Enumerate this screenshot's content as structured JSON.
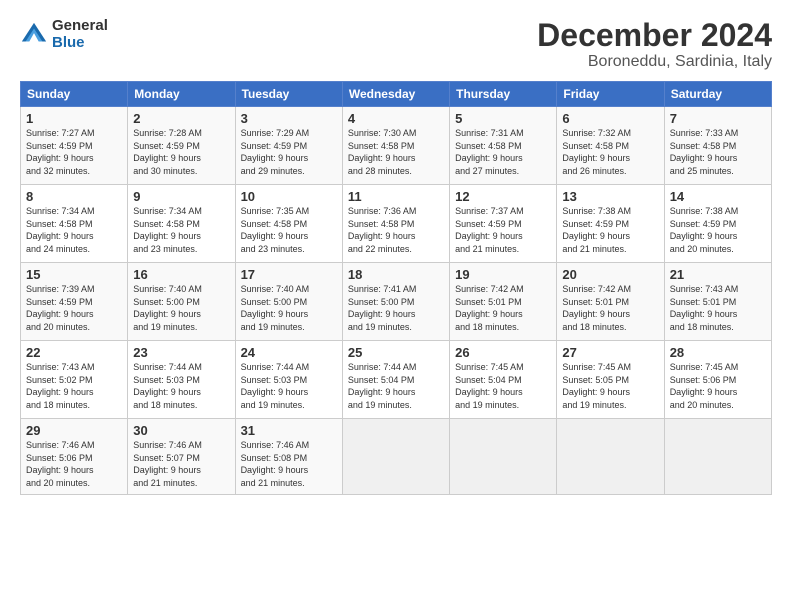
{
  "header": {
    "logo_general": "General",
    "logo_blue": "Blue",
    "month_title": "December 2024",
    "location": "Boroneddu, Sardinia, Italy"
  },
  "days_of_week": [
    "Sunday",
    "Monday",
    "Tuesday",
    "Wednesday",
    "Thursday",
    "Friday",
    "Saturday"
  ],
  "weeks": [
    [
      {
        "day": "1",
        "lines": [
          "Sunrise: 7:27 AM",
          "Sunset: 4:59 PM",
          "Daylight: 9 hours",
          "and 32 minutes."
        ]
      },
      {
        "day": "2",
        "lines": [
          "Sunrise: 7:28 AM",
          "Sunset: 4:59 PM",
          "Daylight: 9 hours",
          "and 30 minutes."
        ]
      },
      {
        "day": "3",
        "lines": [
          "Sunrise: 7:29 AM",
          "Sunset: 4:59 PM",
          "Daylight: 9 hours",
          "and 29 minutes."
        ]
      },
      {
        "day": "4",
        "lines": [
          "Sunrise: 7:30 AM",
          "Sunset: 4:58 PM",
          "Daylight: 9 hours",
          "and 28 minutes."
        ]
      },
      {
        "day": "5",
        "lines": [
          "Sunrise: 7:31 AM",
          "Sunset: 4:58 PM",
          "Daylight: 9 hours",
          "and 27 minutes."
        ]
      },
      {
        "day": "6",
        "lines": [
          "Sunrise: 7:32 AM",
          "Sunset: 4:58 PM",
          "Daylight: 9 hours",
          "and 26 minutes."
        ]
      },
      {
        "day": "7",
        "lines": [
          "Sunrise: 7:33 AM",
          "Sunset: 4:58 PM",
          "Daylight: 9 hours",
          "and 25 minutes."
        ]
      }
    ],
    [
      {
        "day": "8",
        "lines": [
          "Sunrise: 7:34 AM",
          "Sunset: 4:58 PM",
          "Daylight: 9 hours",
          "and 24 minutes."
        ]
      },
      {
        "day": "9",
        "lines": [
          "Sunrise: 7:34 AM",
          "Sunset: 4:58 PM",
          "Daylight: 9 hours",
          "and 23 minutes."
        ]
      },
      {
        "day": "10",
        "lines": [
          "Sunrise: 7:35 AM",
          "Sunset: 4:58 PM",
          "Daylight: 9 hours",
          "and 23 minutes."
        ]
      },
      {
        "day": "11",
        "lines": [
          "Sunrise: 7:36 AM",
          "Sunset: 4:58 PM",
          "Daylight: 9 hours",
          "and 22 minutes."
        ]
      },
      {
        "day": "12",
        "lines": [
          "Sunrise: 7:37 AM",
          "Sunset: 4:59 PM",
          "Daylight: 9 hours",
          "and 21 minutes."
        ]
      },
      {
        "day": "13",
        "lines": [
          "Sunrise: 7:38 AM",
          "Sunset: 4:59 PM",
          "Daylight: 9 hours",
          "and 21 minutes."
        ]
      },
      {
        "day": "14",
        "lines": [
          "Sunrise: 7:38 AM",
          "Sunset: 4:59 PM",
          "Daylight: 9 hours",
          "and 20 minutes."
        ]
      }
    ],
    [
      {
        "day": "15",
        "lines": [
          "Sunrise: 7:39 AM",
          "Sunset: 4:59 PM",
          "Daylight: 9 hours",
          "and 20 minutes."
        ]
      },
      {
        "day": "16",
        "lines": [
          "Sunrise: 7:40 AM",
          "Sunset: 5:00 PM",
          "Daylight: 9 hours",
          "and 19 minutes."
        ]
      },
      {
        "day": "17",
        "lines": [
          "Sunrise: 7:40 AM",
          "Sunset: 5:00 PM",
          "Daylight: 9 hours",
          "and 19 minutes."
        ]
      },
      {
        "day": "18",
        "lines": [
          "Sunrise: 7:41 AM",
          "Sunset: 5:00 PM",
          "Daylight: 9 hours",
          "and 19 minutes."
        ]
      },
      {
        "day": "19",
        "lines": [
          "Sunrise: 7:42 AM",
          "Sunset: 5:01 PM",
          "Daylight: 9 hours",
          "and 18 minutes."
        ]
      },
      {
        "day": "20",
        "lines": [
          "Sunrise: 7:42 AM",
          "Sunset: 5:01 PM",
          "Daylight: 9 hours",
          "and 18 minutes."
        ]
      },
      {
        "day": "21",
        "lines": [
          "Sunrise: 7:43 AM",
          "Sunset: 5:01 PM",
          "Daylight: 9 hours",
          "and 18 minutes."
        ]
      }
    ],
    [
      {
        "day": "22",
        "lines": [
          "Sunrise: 7:43 AM",
          "Sunset: 5:02 PM",
          "Daylight: 9 hours",
          "and 18 minutes."
        ]
      },
      {
        "day": "23",
        "lines": [
          "Sunrise: 7:44 AM",
          "Sunset: 5:03 PM",
          "Daylight: 9 hours",
          "and 18 minutes."
        ]
      },
      {
        "day": "24",
        "lines": [
          "Sunrise: 7:44 AM",
          "Sunset: 5:03 PM",
          "Daylight: 9 hours",
          "and 19 minutes."
        ]
      },
      {
        "day": "25",
        "lines": [
          "Sunrise: 7:44 AM",
          "Sunset: 5:04 PM",
          "Daylight: 9 hours",
          "and 19 minutes."
        ]
      },
      {
        "day": "26",
        "lines": [
          "Sunrise: 7:45 AM",
          "Sunset: 5:04 PM",
          "Daylight: 9 hours",
          "and 19 minutes."
        ]
      },
      {
        "day": "27",
        "lines": [
          "Sunrise: 7:45 AM",
          "Sunset: 5:05 PM",
          "Daylight: 9 hours",
          "and 19 minutes."
        ]
      },
      {
        "day": "28",
        "lines": [
          "Sunrise: 7:45 AM",
          "Sunset: 5:06 PM",
          "Daylight: 9 hours",
          "and 20 minutes."
        ]
      }
    ],
    [
      {
        "day": "29",
        "lines": [
          "Sunrise: 7:46 AM",
          "Sunset: 5:06 PM",
          "Daylight: 9 hours",
          "and 20 minutes."
        ]
      },
      {
        "day": "30",
        "lines": [
          "Sunrise: 7:46 AM",
          "Sunset: 5:07 PM",
          "Daylight: 9 hours",
          "and 21 minutes."
        ]
      },
      {
        "day": "31",
        "lines": [
          "Sunrise: 7:46 AM",
          "Sunset: 5:08 PM",
          "Daylight: 9 hours",
          "and 21 minutes."
        ]
      },
      null,
      null,
      null,
      null
    ]
  ]
}
